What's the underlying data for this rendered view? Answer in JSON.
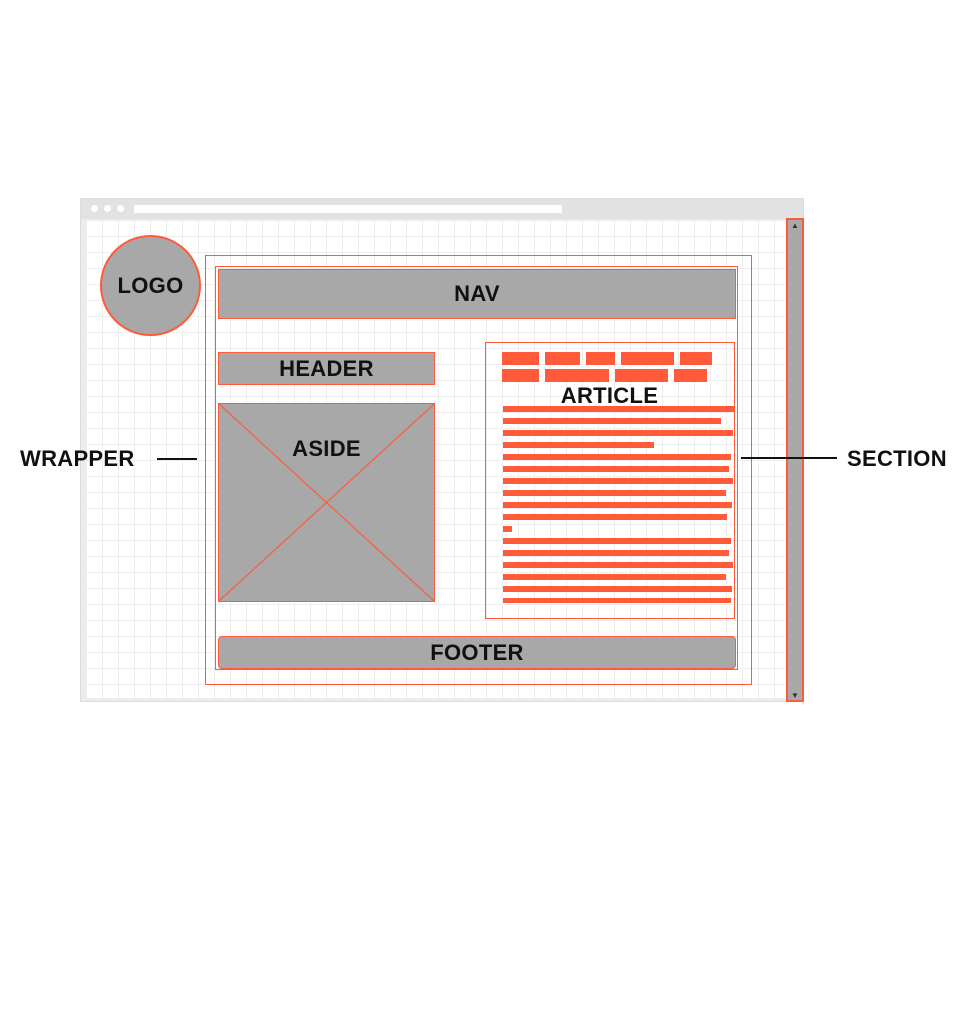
{
  "labels": {
    "logo": "LOGO",
    "nav": "NAV",
    "header": "HEADER",
    "aside": "ASIDE",
    "article": "ARTICLE",
    "footer": "FOOTER",
    "wrapper": "WRAPPER",
    "section": "SECTION"
  },
  "scrollbar": {
    "up_arrow": "▲",
    "down_arrow": "▼"
  },
  "colors": {
    "accent": "#ff5b3a",
    "block_fill": "#a8a8a8",
    "grid_line": "#eeeeee",
    "text": "#111111"
  }
}
